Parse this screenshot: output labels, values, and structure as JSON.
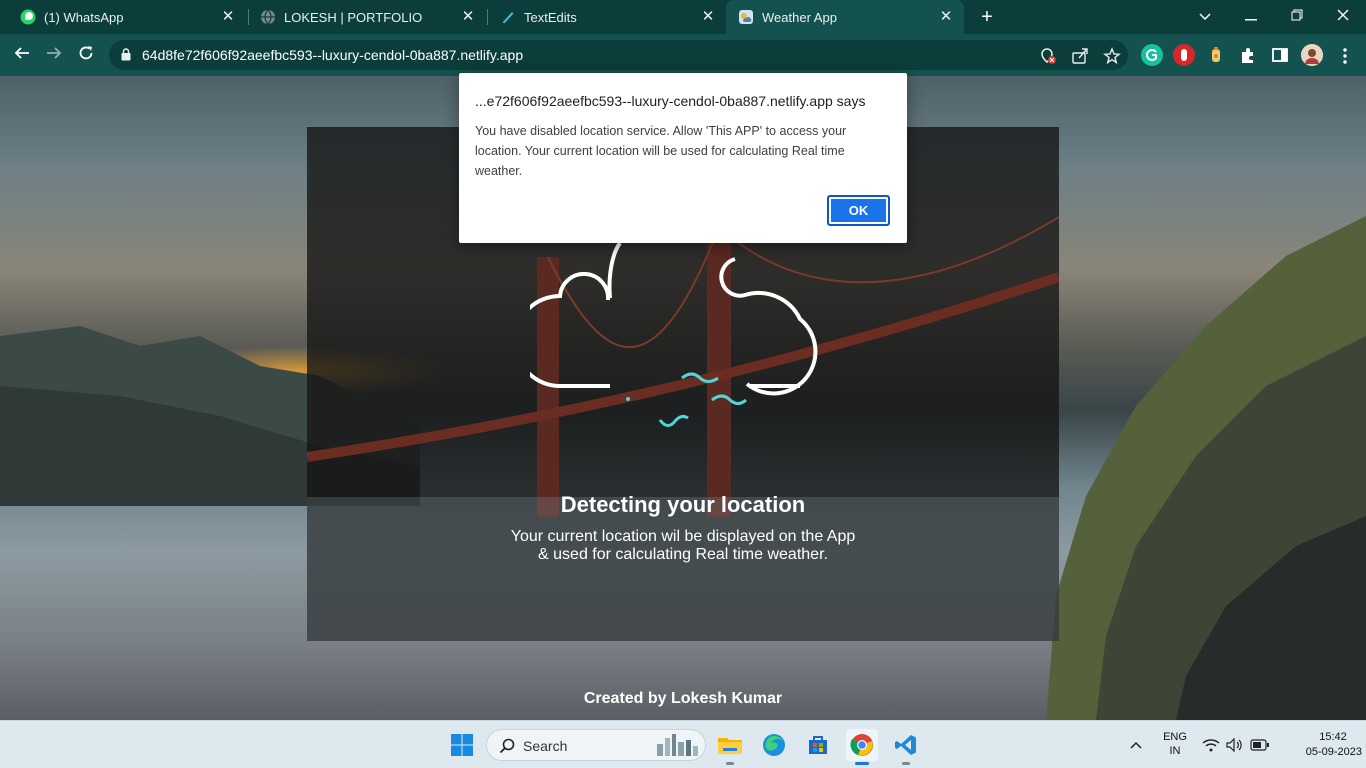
{
  "browser": {
    "tabs": [
      {
        "label": "(1) WhatsApp",
        "close": "✕"
      },
      {
        "label": "LOKESH | PORTFOLIO",
        "close": "✕"
      },
      {
        "label": "TextEdits",
        "close": "✕"
      },
      {
        "label": "Weather App",
        "close": "✕"
      }
    ],
    "new_tab": "+",
    "url": "64d8fe72f606f92aeefbc593--luxury-cendol-0ba887.netlify.app"
  },
  "dialog": {
    "title": "...e72f606f92aeefbc593--luxury-cendol-0ba887.netlify.app says",
    "message": "You have disabled location service. Allow 'This APP' to access your location. Your current location will be used for calculating Real time weather.",
    "ok_label": "OK"
  },
  "app": {
    "heading": "Detecting your location",
    "subtext_line1": "Your current location wil be displayed on the App",
    "subtext_line2": "& used for calculating Real time weather.",
    "credit": "Created by Lokesh Kumar"
  },
  "taskbar": {
    "search_label": "Search",
    "language_line1": "ENG",
    "language_line2": "IN",
    "time": "15:42",
    "date": "05-09-2023"
  },
  "colors": {
    "accent_cyan": "#4fd6d6",
    "chrome_dark": "#0b3d3b",
    "chrome_toolbar": "#14524f",
    "dialog_button": "#1a73e8"
  }
}
